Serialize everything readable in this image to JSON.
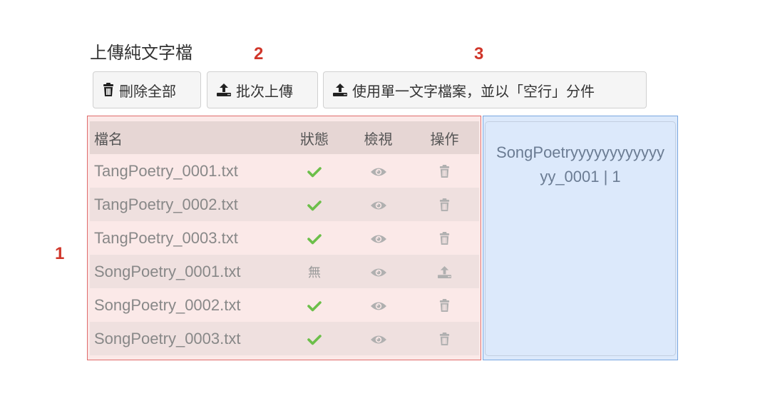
{
  "page_title": "上傳純文字檔",
  "markers": {
    "table": "1",
    "batch": "2",
    "single": "3"
  },
  "toolbar": {
    "delete_all": "刪除全部",
    "batch_upload": "批次上傳",
    "single_file": "使用單一文字檔案，並以「空行」分件"
  },
  "table": {
    "headers": {
      "name": "檔名",
      "status": "狀態",
      "view": "檢視",
      "action": "操作"
    },
    "rows": [
      {
        "name": "TangPoetry_0001.txt",
        "status": "ok",
        "status_text": "",
        "action": "delete-icon"
      },
      {
        "name": "TangPoetry_0002.txt",
        "status": "ok",
        "status_text": "",
        "action": "delete-icon"
      },
      {
        "name": "TangPoetry_0003.txt",
        "status": "ok",
        "status_text": "",
        "action": "delete-icon"
      },
      {
        "name": "SongPoetry_0001.txt",
        "status": "none",
        "status_text": "無",
        "action": "upload-icon"
      },
      {
        "name": "SongPoetry_0002.txt",
        "status": "ok",
        "status_text": "",
        "action": "delete-icon"
      },
      {
        "name": "SongPoetry_0003.txt",
        "status": "ok",
        "status_text": "",
        "action": "delete-icon"
      }
    ]
  },
  "preview": {
    "text": "SongPoetryyyyyyyyyyyyyy_0001 | 1"
  },
  "colors": {
    "check": "#6cbf4a",
    "icon_gray": "#b0b0b0",
    "marker": "#d0362a",
    "left_panel_border": "#e06b6b",
    "right_panel_border": "#7aa7e0"
  }
}
